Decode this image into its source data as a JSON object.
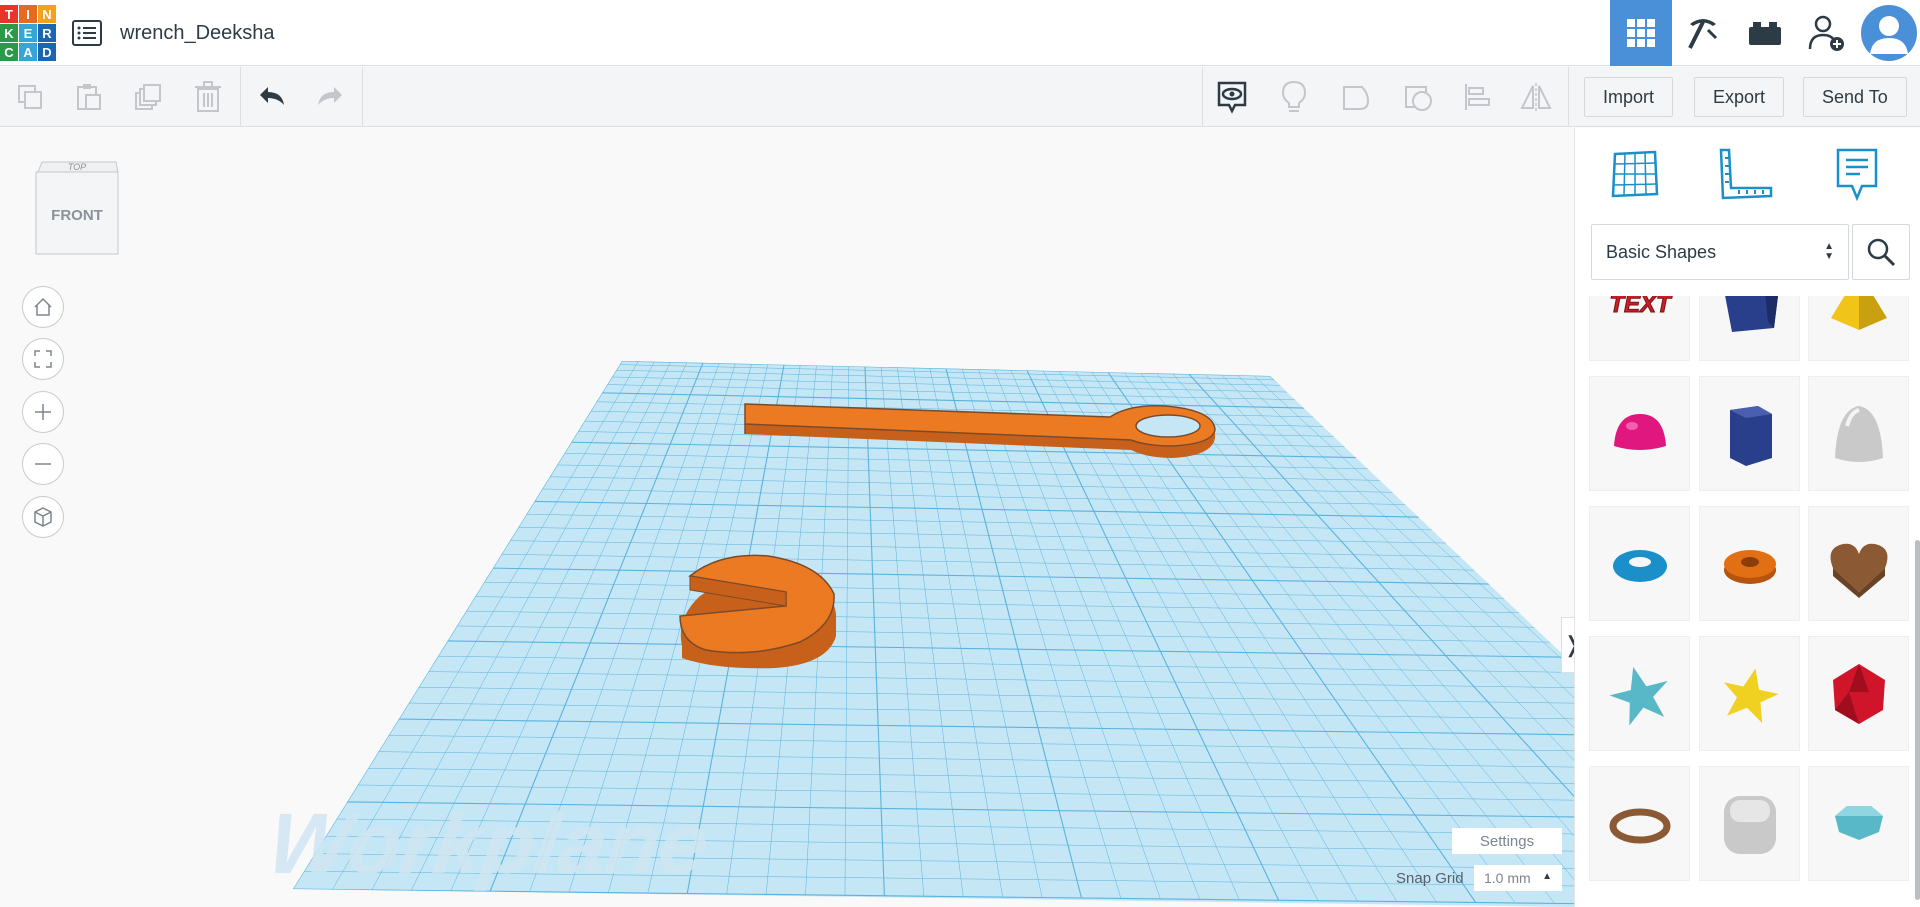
{
  "header": {
    "logo_letters": [
      "T",
      "I",
      "N",
      "K",
      "E",
      "R",
      "C",
      "A",
      "D"
    ],
    "logo_colors": [
      "#e8342a",
      "#e86a1e",
      "#f4a21d",
      "#2a9a49",
      "#35a5d8",
      "#1a66b2",
      "#2a9a49",
      "#35a5d8",
      "#1a66b2"
    ],
    "design_title": "wrench_Deeksha",
    "designs_icon": "list-icon",
    "right_icons": [
      "grid-view-icon",
      "pickaxe-icon",
      "bricks-icon",
      "add-user-icon",
      "avatar-icon"
    ]
  },
  "toolbar": {
    "left_icons": [
      "copy-icon",
      "paste-icon",
      "duplicate-icon",
      "trash-icon",
      "undo-icon",
      "redo-icon"
    ],
    "right_icons": [
      "notes-toggle-icon",
      "light-bulb-icon",
      "solid-shape-icon",
      "hole-shape-icon",
      "align-icon",
      "mirror-icon"
    ],
    "import_label": "Import",
    "export_label": "Export",
    "send_to_label": "Send To"
  },
  "viewport": {
    "viewcube_top": "TOP",
    "viewcube_front": "FRONT",
    "workplane_label": "Workplane",
    "settings_label": "Settings",
    "snap_grid_label": "Snap Grid",
    "snap_grid_value": "1.0 mm",
    "nav_icons": [
      "home-icon",
      "fit-view-icon",
      "zoom-in-icon",
      "zoom-out-icon",
      "perspective-icon"
    ],
    "collapse_glyph": "❭"
  },
  "panel": {
    "top_icons": [
      "workplane-icon",
      "ruler-icon",
      "notes-icon"
    ],
    "library_selected": "Basic Shapes",
    "search_icon": "search-icon",
    "shapes": [
      {
        "name": "text",
        "color": "#cc1f25",
        "glyph": "TEXT"
      },
      {
        "name": "box",
        "color": "#2a3f8c"
      },
      {
        "name": "pyramid",
        "color": "#f0c419"
      },
      {
        "name": "half-sphere",
        "color": "#e0177f"
      },
      {
        "name": "polygon",
        "color": "#2a3f8c"
      },
      {
        "name": "paraboloid",
        "color": "#c9c9c9"
      },
      {
        "name": "torus",
        "color": "#1a8fc9"
      },
      {
        "name": "tube",
        "color": "#e36f15"
      },
      {
        "name": "heart",
        "color": "#8b5a35"
      },
      {
        "name": "star",
        "color": "#58b8c8"
      },
      {
        "name": "star-yellow",
        "color": "#f0d020"
      },
      {
        "name": "icosahedron",
        "color": "#d0152a"
      },
      {
        "name": "ring",
        "color": "#8b5a35"
      },
      {
        "name": "rounded-box",
        "color": "#c9c9c9"
      },
      {
        "name": "gem",
        "color": "#58b8c8"
      }
    ]
  }
}
